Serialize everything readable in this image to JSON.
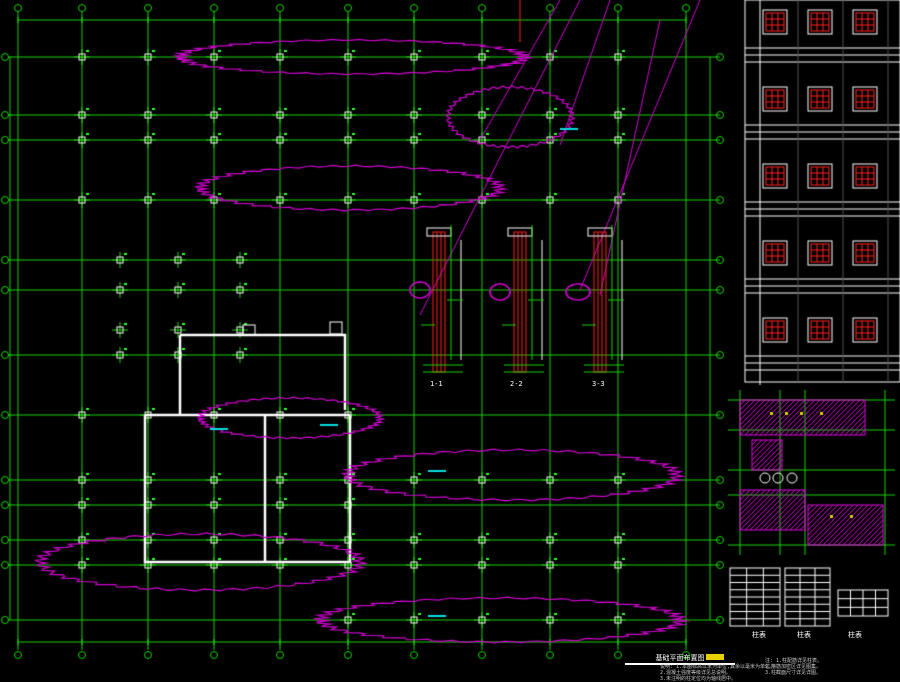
{
  "drawing": {
    "background": "#000000",
    "colors": {
      "grid": "#19d400",
      "column": "#ffffff",
      "cloud": "#d000d0",
      "rebar": "#ff2020",
      "hatch": "#e000e0",
      "text": "#ffffff",
      "cyan_text": "#00e0e0",
      "yellow": "#e8d000"
    },
    "title_label": "基础平面布置图",
    "notes": [
      "说明: 1.本图标高以米为单位,其余以毫米为单位。",
      "2.混凝土强度等级详见总说明。",
      "3.未注明的柱定位均为轴线居中。"
    ],
    "notes_right": [
      "注: 1.柱配筋详见柱表。",
      "2.箍筋加密区详见图集。",
      "3.柱截面尺寸详见详图。"
    ],
    "section_labels": [
      "1-1",
      "2-2",
      "3-3"
    ],
    "table_labels": [
      "柱表",
      "柱表",
      "柱表"
    ]
  }
}
